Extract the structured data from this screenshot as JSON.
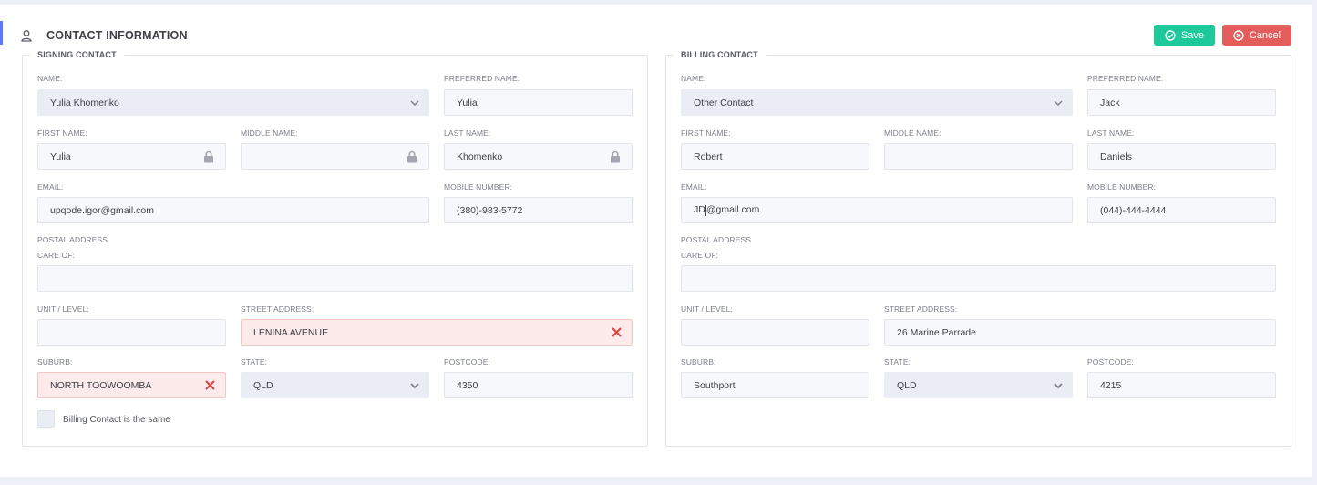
{
  "header": {
    "title": "CONTACT INFORMATION",
    "save_label": "Save",
    "cancel_label": "Cancel"
  },
  "labels": {
    "name": "NAME:",
    "preferred_name": "PREFERRED NAME:",
    "first_name": "FIRST NAME:",
    "middle_name": "MIDDLE NAME:",
    "last_name": "LAST NAME:",
    "email": "EMAIL:",
    "mobile": "MOBILE NUMBER:",
    "postal_address": "POSTAL ADDRESS",
    "care_of": "CARE OF:",
    "unit": "UNIT / LEVEL:",
    "street": "STREET ADDRESS:",
    "suburb": "SUBURB:",
    "state": "STATE:",
    "postcode": "POSTCODE:"
  },
  "signing": {
    "legend": "SIGNING CONTACT",
    "name": "Yulia Khomenko",
    "preferred_name": "Yulia",
    "first_name": "Yulia",
    "middle_name": "",
    "last_name": "Khomenko",
    "email": "upqode.igor@gmail.com",
    "mobile": "(380)-983-5772",
    "care_of": "",
    "unit": "",
    "street": "LENINA AVENUE",
    "suburb": "NORTH TOOWOOMBA",
    "state": "QLD",
    "postcode": "4350",
    "billing_same_label": "Billing Contact is the same"
  },
  "billing": {
    "legend": "BILLING CONTACT",
    "name": "Other Contact",
    "preferred_name": "Jack",
    "first_name": "Robert",
    "middle_name": "",
    "last_name": "Daniels",
    "email_before_caret": "JD",
    "email_after_caret": "@gmail.com",
    "mobile": "(044)-444-4444",
    "care_of": "",
    "unit": "",
    "street": "26 Marine Parrade",
    "suburb": "Southport",
    "state": "QLD",
    "postcode": "4215"
  },
  "colors": {
    "save": "#1dc99a",
    "cancel": "#e35d5d",
    "error_bg": "#fdeaea",
    "error_icon": "#e0403f",
    "field_bg": "#f7f8fc"
  }
}
